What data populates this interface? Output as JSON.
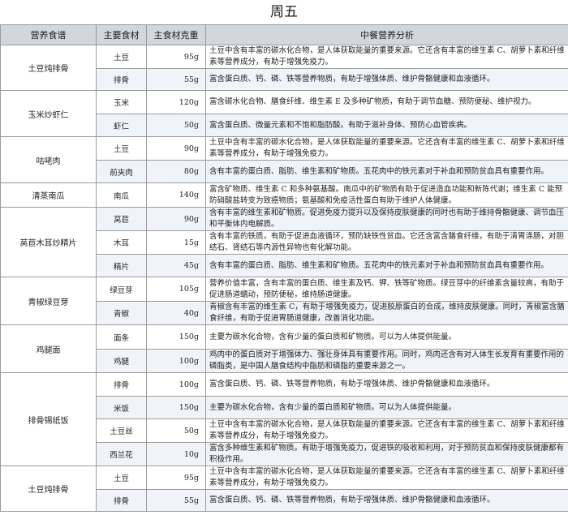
{
  "title": "周五",
  "headers": [
    "营养食谱",
    "主要食材",
    "主食材克重",
    "中餐营养分析"
  ],
  "dishes": [
    {
      "name": "土豆炖排骨",
      "rows": [
        {
          "ingredient": "土豆",
          "weight": "95g",
          "analysis": "土豆中含有丰富的碳水化合物，是人体获取能量的重要来源。它还含有丰富的维生素 C、胡萝卜素和纤维素等营养成分，有助于增强免疫力。"
        },
        {
          "ingredient": "排骨",
          "weight": "55g",
          "analysis": "富含蛋白质、钙、磷、铁等营养物质，有助于增强体质、维护骨骼健康和血液循环。"
        }
      ]
    },
    {
      "name": "玉米炒虾仁",
      "rows": [
        {
          "ingredient": "玉米",
          "weight": "120g",
          "analysis": "富含碳水化合物、膳食纤维、维生素 E 及多种矿物质，有助于调节血糖、预防便秘、维护视力。"
        },
        {
          "ingredient": "虾仁",
          "weight": "50g",
          "analysis": "富含蛋白质、微量元素和不饱和脂肪酸。有助于滋补身体、预防心血管疾病。"
        }
      ]
    },
    {
      "name": "咕咾肉",
      "rows": [
        {
          "ingredient": "土豆",
          "weight": "90g",
          "analysis": "土豆中含有丰富的碳水化合物，是人体获取能量的重要来源。它还含有丰富的维生素 C、胡萝卜素和纤维素等营养成分，有助于增强免疫力。"
        },
        {
          "ingredient": "前夹肉",
          "weight": "80g",
          "analysis": "含有丰富的蛋白质、脂肪、维生素和矿物质。五花肉中的铁元素对于补血和预防贫血具有重要作用。"
        }
      ]
    },
    {
      "name": "清蒸南瓜",
      "rows": [
        {
          "ingredient": "南瓜",
          "weight": "140g",
          "analysis": "富含矿物质、维生素 C 和多种氨基酸。南瓜中的矿物质有助于促进造血功能和新陈代谢；维生素 C 能预防硝酸盐转变为致癌物质；氨基酸和免疫活性蛋白有助于维护人体健康。"
        }
      ]
    },
    {
      "name": "莴苣木耳炒精片",
      "rows": [
        {
          "ingredient": "莴苣",
          "weight": "90g",
          "analysis": "含有丰富的维生素和矿物质。促进免疫力提升以及保持皮肤健康的同时也有助于维持骨骼健康、调节血压和平衡体内电解质。"
        },
        {
          "ingredient": "木耳",
          "weight": "15g",
          "analysis": "含有丰富的铁质，有助于促进血液循环，预防缺铁性贫血。它还含富含膳食纤维，有助于清胃涤肠，对胆结石、肾结石等内源性异物也有化解功能。"
        },
        {
          "ingredient": "精片",
          "weight": "45g",
          "analysis": "含有丰富的蛋白质、脂肪、维生素和矿物质。五花肉中的铁元素对于补血和预防贫血具有重要作用。"
        }
      ]
    },
    {
      "name": "青椒绿豆芽",
      "rows": [
        {
          "ingredient": "绿豆芽",
          "weight": "105g",
          "analysis": "营养价值丰富，含有丰富的蛋白质、维生素及钙、钾、铁等矿物质。绿豆芽中的纤维素含量较高，有助于促进肠道蠕动，预防便秘，维持肠道健康。"
        },
        {
          "ingredient": "青椒",
          "weight": "40g",
          "analysis": "青椒含有丰富的维生素 C，有助于增强免疫力，促进胶原蛋白的合成，维持皮肤健康。同时，青椒富含膳食纤维，有助于促进胃肠道健康，改善消化功能。"
        }
      ]
    },
    {
      "name": "鸡腿面",
      "rows": [
        {
          "ingredient": "面条",
          "weight": "150g",
          "analysis": "主要为碳水化合物，含有少量的蛋白质和矿物质。可以为人体提供能量。"
        },
        {
          "ingredient": "鸡腿",
          "weight": "100g",
          "analysis": "鸡肉中的蛋白质对于增强体力、强壮身体具有重要作用。同时，鸡肉还含有对人体生长发育有重要作用的磷脂类，是中国人膳食结构中脂肪和磷脂的重要来源之一。"
        }
      ]
    },
    {
      "name": "排骨锡纸饭",
      "rows": [
        {
          "ingredient": "排骨",
          "weight": "100g",
          "analysis": "富含蛋白质、钙、磷、铁等营养物质，有助于增强体质、维护骨骼健康和血液循环。"
        },
        {
          "ingredient": "米饭",
          "weight": "150g",
          "analysis": "主要为碳水化合物，含有少量的蛋白质和矿物质。可以为人体提供能量。"
        },
        {
          "ingredient": "土豆丝",
          "weight": "50g",
          "analysis": "土豆中含有丰富的碳水化合物，是人体获取能量的重要来源。它还含有丰富的维生素 C、胡萝卜素和纤维素等营养成分，有助于增强免疫力。"
        },
        {
          "ingredient": "西兰花",
          "weight": "10g",
          "analysis": "富含多种维生素和矿物质。有助于增强免疫力，促进铁的吸收和利用，对于预防贫血和保持皮肤健康都有积极作用。"
        }
      ]
    },
    {
      "name": "土豆炖排骨",
      "rows": [
        {
          "ingredient": "土豆",
          "weight": "95g",
          "analysis": "土豆中含有丰富的碳水化合物，是人体获取能量的重要来源。它还含有丰富的维生素 C、胡萝卜素和纤维素等营养成分，有助于增强免疫力。"
        },
        {
          "ingredient": "排骨",
          "weight": "55g",
          "analysis": "富含蛋白质、钙、磷、铁等营养物质，有助于增强体质、维护骨骼健康和血液循环。"
        }
      ]
    }
  ]
}
